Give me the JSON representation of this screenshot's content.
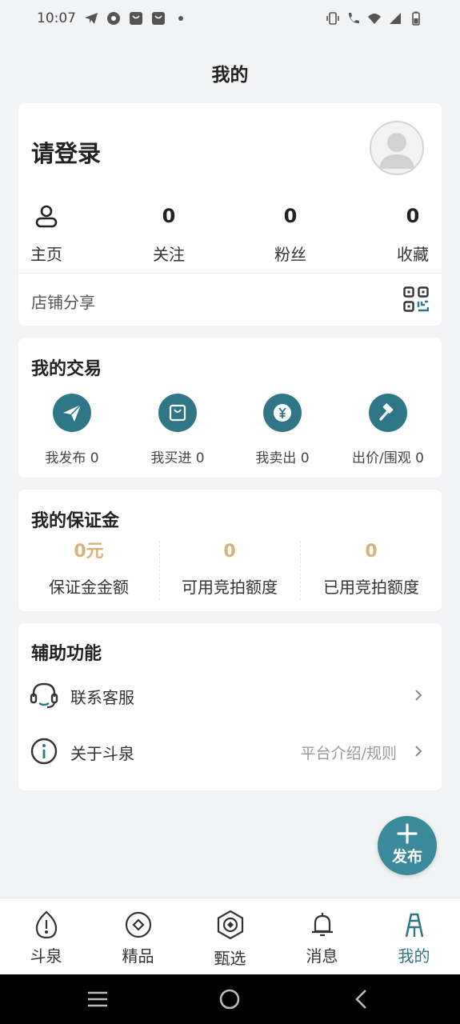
{
  "status_bar": {
    "time": "10:07",
    "icons_left": [
      "telegram-icon",
      "chrome-icon",
      "shopping-bag-icon",
      "shopping-bag-icon",
      "dot-icon"
    ],
    "icons_right": [
      "vibrate-icon",
      "wifi-call-icon",
      "wifi-icon",
      "signal-icon",
      "battery-icon"
    ]
  },
  "header": {
    "title": "我的"
  },
  "profile": {
    "login_prompt": "请登录",
    "stats": [
      {
        "icon": "user-icon",
        "label": "主页"
      },
      {
        "value": "0",
        "label": "关注"
      },
      {
        "value": "0",
        "label": "粉丝"
      },
      {
        "value": "0",
        "label": "收藏"
      }
    ],
    "share_label": "店铺分享"
  },
  "trade": {
    "title": "我的交易",
    "items": [
      {
        "icon": "paper-plane-icon",
        "label": "我发布 0"
      },
      {
        "icon": "shopping-bag-icon",
        "label": "我买进 0"
      },
      {
        "icon": "yen-coin-icon",
        "label": "我卖出 0"
      },
      {
        "icon": "auction-hammer-icon",
        "label": "出价/围观 0"
      }
    ]
  },
  "deposit": {
    "title": "我的保证金",
    "items": [
      {
        "value": "0元",
        "label": "保证金金额"
      },
      {
        "value": "0",
        "label": "可用竞拍额度"
      },
      {
        "value": "0",
        "label": "已用竞拍额度"
      }
    ]
  },
  "aux": {
    "title": "辅助功能",
    "items": [
      {
        "icon": "headset-icon",
        "label": "联系客服",
        "right": ""
      },
      {
        "icon": "info-icon",
        "label": "关于斗泉",
        "right": "平台介绍/规则"
      }
    ]
  },
  "fab": {
    "label": "发布"
  },
  "bottom_nav": {
    "items": [
      {
        "icon": "coin-drop-icon",
        "label": "斗泉"
      },
      {
        "icon": "diamond-circle-icon",
        "label": "精品"
      },
      {
        "icon": "hexagon-target-icon",
        "label": "甄选"
      },
      {
        "icon": "bell-icon",
        "label": "消息"
      },
      {
        "icon": "me-logo-icon",
        "label": "我的",
        "active": true
      }
    ]
  },
  "colors": {
    "accent": "#2f7788",
    "deposit_value": "#d8b278",
    "background": "#f2f3f5"
  }
}
